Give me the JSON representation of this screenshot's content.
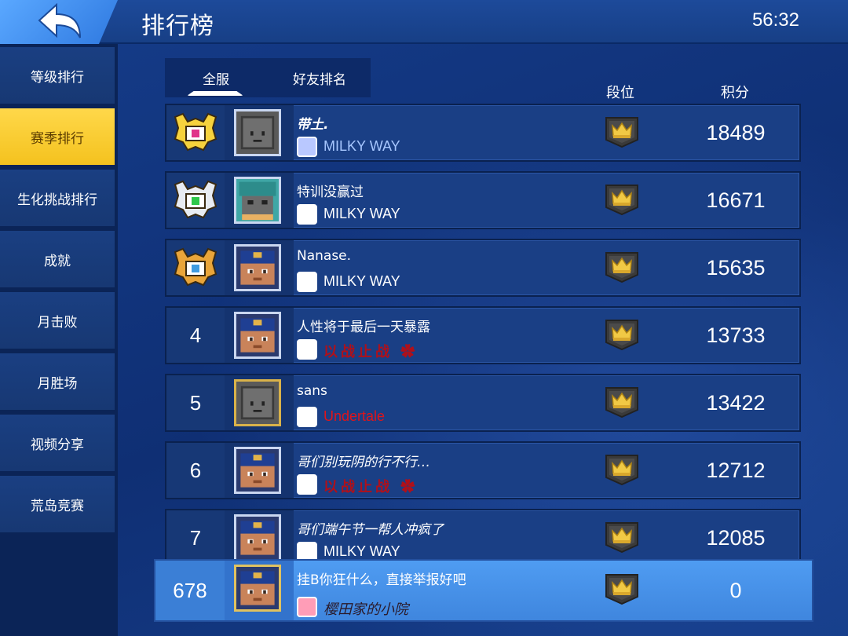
{
  "header": {
    "title": "排行榜",
    "clock": "56:32"
  },
  "sidebar": {
    "items": [
      {
        "label": "等级排行",
        "active": false
      },
      {
        "label": "赛季排行",
        "active": true
      },
      {
        "label": "生化挑战排行",
        "active": false
      },
      {
        "label": "成就",
        "active": false
      },
      {
        "label": "月击败",
        "active": false
      },
      {
        "label": "月胜场",
        "active": false
      },
      {
        "label": "视频分享",
        "active": false
      },
      {
        "label": "荒岛竞赛",
        "active": false
      }
    ]
  },
  "tabs": [
    {
      "label": "全服",
      "active": true
    },
    {
      "label": "好友排名",
      "active": false
    }
  ],
  "columns": {
    "tier": "段位",
    "score": "积分"
  },
  "rows": [
    {
      "rank": "",
      "medal": "gold-medal-icon",
      "name": "带土.",
      "clan": "MILKY WAY",
      "score": "18489"
    },
    {
      "rank": "",
      "medal": "silver-medal-icon",
      "name": "特训没赢过",
      "clan": "MILKY WAY",
      "score": "16671"
    },
    {
      "rank": "",
      "medal": "bronze-medal-icon",
      "name": "Nanase.",
      "clan": "MILKY WAY",
      "score": "15635"
    },
    {
      "rank": "4",
      "name": "人性将于最后一天暴露",
      "clan": "以战止战 ✿",
      "score": "13733"
    },
    {
      "rank": "5",
      "name": "sans",
      "clan": "Undertale",
      "score": "13422"
    },
    {
      "rank": "6",
      "name": "哥们别玩阴的行不行…",
      "clan": "以战止战 ✿",
      "score": "12712"
    },
    {
      "rank": "7",
      "name": "哥们端午节一帮人冲疯了",
      "clan": "MILKY WAY",
      "score": "12085"
    }
  ],
  "self": {
    "rank": "678",
    "name": "挂B你狂什么，直接举报好吧",
    "clan": "樱田家的小院",
    "score": "0"
  },
  "colors": {
    "active_tab": "#f4c21e",
    "accent": "#3f86de"
  }
}
